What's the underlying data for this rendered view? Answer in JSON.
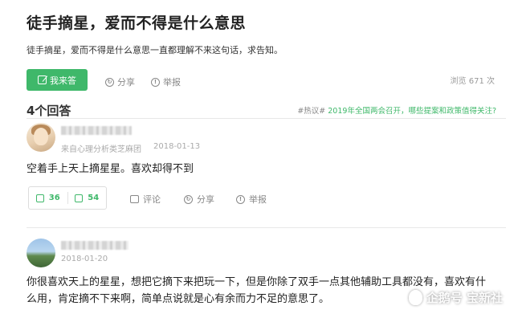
{
  "question": {
    "title": "徒手摘星，爱而不得是什么意思",
    "description": "徒手摘星，爱而不得是什么意思一直都理解不来这句话，求告知。",
    "answer_button": "我来答",
    "share": "分享",
    "report": "举报",
    "views": "浏览 671 次"
  },
  "answers_header": {
    "count": "4个回答",
    "hot_tag": "#热议#",
    "hot_topic": "2019年全国两会召开，哪些提案和政策值得关注?"
  },
  "answers": [
    {
      "source": "来自心理分析类芝麻团",
      "date": "2018-01-13",
      "text": "空着手上天上摘星星。喜欢却得不到",
      "likes": "36",
      "dislikes": "54",
      "comment": "评论",
      "share": "分享",
      "report": "举报"
    },
    {
      "date": "2018-01-20",
      "text_line1": "你很喜欢天上的星星，想把它摘下来把玩一下，但是你除了双手一点其他辅助工具都没有，喜欢有什",
      "text_line2": "么用，肯定摘不下来啊，简单点说就是心有余而力不足的意思了。"
    }
  ],
  "watermark": "企鹅号 宝新社",
  "colors": {
    "accent": "#3fb86a"
  }
}
